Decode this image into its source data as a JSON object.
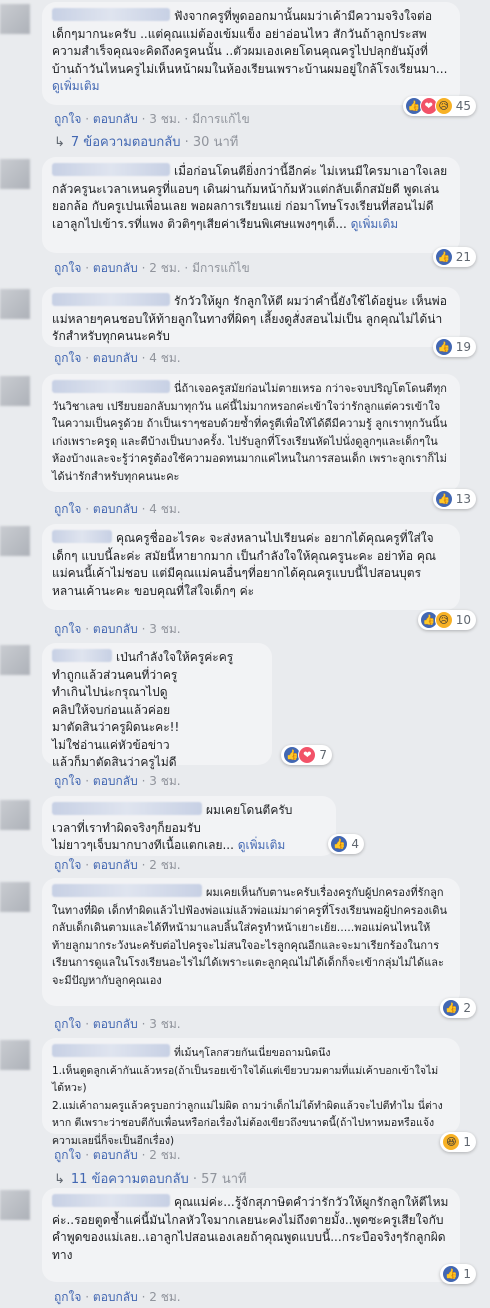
{
  "actions": {
    "like": "ถูกใจ",
    "reply": "ตอบกลับ",
    "dot": "·",
    "edited": "มีการแก้ไข",
    "see_more": "ดูเพิ่มเติม"
  },
  "comments": [
    {
      "text": "ฟังจากครูที่พูดออกมานั้นผมว่าเค้ามีความจริงใจต่อเด็กๆมากนะครับ ..แต่คุณแม่ต้องเข้มแข็ง อย่าอ่อนไหว สักวันถ้าลูกประสพความสำเร็จคุณจะคิดถึงครูคนนั้น ..ตัวผมเองเคยโดนคุณครูไปปลุกยันมุ้งที่บ้านถ้าวันไหนครูไม่เห็นหน้าผมในห้องเรียนเพราะบ้านผมอยู่ใกล้โรงเรียนมา...",
      "see_more": true,
      "time": "3 ชม.",
      "edited": true,
      "reactions": {
        "icons": [
          "like",
          "love",
          "sad"
        ],
        "count": "45"
      }
    },
    {
      "text": "เมื่อก่อนโดนตียิ่งกว่านี้อีกค่ะ ไม่เหนมีใครมาเอาใจเลย กลัวครูนะเวลาเหนครูที่แอบๆ เดินผ่านก้มหน้าก้มหัวแต่กลับเด็กสมัยดี พูดเล่นยอกล้อ กับครูเปนเพื่อนเลย พอผลการเรียนแย่ ก่อมาโทษโรงเรียนที่สอนไม่ดีเอาลูกไปเข้าร.รที่แพง ติวติๆๆเสียค่าเรียนพิเศษแพงๆๆเต็...",
      "see_more": true,
      "time": "2 ชม.",
      "edited": true,
      "reactions": {
        "icons": [
          "like"
        ],
        "count": "21"
      }
    },
    {
      "text": "รักวัวให้ผูก รักลูกให้ตี ผมว่าคำนี้ยังใช้ได้อยู่นะ เห็นพ่อแม่หลายๆคนชอบให้ท้ายลูกในทางที่ผิดๆ เลี้ยงดูสั่งสอนไม่เป็น ลูกคุณไม่ได้น่ารักสำหรับทุกคนนะครับ",
      "see_more": false,
      "time": "4 ชม.",
      "edited": false,
      "reactions": {
        "icons": [
          "like"
        ],
        "count": "19"
      }
    },
    {
      "text": "นี่ถ้าเจอครูสมัยก่อนไม่ตายเหรอ กว่าจะจบปริญโตโดนตีทุกวันวิชาเลข เปรียบยอกลับมาทุกวัน แค่นี้ไม่มากหรอกค่ะเข้าใจว่ารักลูกแต่ควรเข้าใจในความเป็นครูด้วย ถ้าเป็นเราๆชอบด้วยซ้ำที่ครูตีเพื่อให้ได้ดีมีความรู้ ลูกเราทุกวันนิ้นเก่งเพราะครูดุ และตีบ้างเป็นบางครั้ง. ไปรับลูกที่โรงเรียนหัดไปนั่งดูลูกๆและเด็กๆในห้องบ้างและจะรู้ว่าครูต้องใช้ความอดทนมากแค่ไหนในการสอนเด็ก เพราะลูกเราก็ไม่ได้น่ารักสำหรับทุกคนนะคะ",
      "see_more": false,
      "time": "4 ชม.",
      "edited": false,
      "reactions": {
        "icons": [
          "like"
        ],
        "count": "13"
      }
    },
    {
      "text": "คุณครูชื่ออะไรคะ จะส่งหลานไปเรียนค่ะ อยากได้คุณครูที่ใส่ใจเด็กๆ แบบนี้ละค่ะ สมัยนี้หายากมาก เป็นกำลังใจให้คุณครูนะคะ อย่าท้อ คุณแม่คนนี้เค้าไม่ชอบ แต่มีคุณแม่คนอื่นๆที่อยากได้คุณครูแบบนี้ไปสอนบุตรหลานเค้านะคะ ขอบคุณที่ใส่ใจเด็กๆ ค่ะ",
      "see_more": false,
      "time": "3 ชม.",
      "edited": false,
      "reactions": {
        "icons": [
          "like",
          "sad"
        ],
        "count": "10"
      }
    },
    {
      "text": "เป่นกำลังใจให้ครูค่ะครู\nทำถูกแล้วส่วนคนที่ว่าครู\nทำเกินไปน่ะกรุณาไปดู\nคลิปให้จบก่อนแล้วค่อย\nมาตัดสินว่าครูผิดนะคะ!!\nไม่ใช่อ่านแค่หัวข้อข่าว\nแล้วก็มาตัดสินว่าครูไม่ดี",
      "see_more": false,
      "time": "3 ชม.",
      "edited": false,
      "reactions": {
        "icons": [
          "like",
          "love"
        ],
        "count": "7"
      }
    },
    {
      "text": "ผมเคยโดนตีครับ\nเวลาที่เราทำผิดจริงๆก็ยอมรับ\nไม่ยาวๆเจ็บมากบางทีเนื้อแตกเลย...",
      "see_more": true,
      "time": "2 ชม.",
      "edited": false,
      "reactions": {
        "icons": [
          "like"
        ],
        "count": "4"
      }
    },
    {
      "text": "ผมเคยเห็นกับตานะครับเรื่องครูกับผู้ปกครองที่รักลูกในทางที่ผิด เด็กทำผิดแล้วไปฟ้องพ่อแม่แล้วพ่อแม่มาด่าครูที่โรงเรียนพอผู้ปกครองเดินกลับเด็กเดินตามและได้ทีหน้ามาแลบลิ้นใส่ครูทำหน้าเยาะเย้ย.....พอแม่คนไหนให้ท้ายลูกมากระวังนะครับต่อไปครูจะไม่สนใจอะไรลูกคุณอีกและจะมาเรียกร้องในการเรียนการดูแลในโรงเรียนอะไรไม่ได้เพราะแตะลูกคุณไม่ได้เด็กก็จะเข้ากลุ่มไม่ได้และจะมีปัญหากับลูกคุณเอง",
      "see_more": false,
      "time": "3 ชม.",
      "edited": false,
      "reactions": {
        "icons": [
          "like"
        ],
        "count": "2"
      }
    },
    {
      "text": "ที่เม้นๆโลกสวยกันเนี่ยขอถามนิดนึง\n1.เห็นตูดลูกเค้ากันแล้วหรอ(ถ้าเป็นรอยเข้าใจได้แต่เขียวบวมตามที่แม่เค้าบอกเข้าใจไม่ได้หวะ)\n2.แม่เค้าถามครูแล้วครูบอกว่าลูกแม่ไม่ผิด ถามว่าเด็กไม่ได้ทำผิดแล้วจะไปตีทำไม นี่ต่างหาก ตีเพราะว่าชอบตีกับเพื่อนหรือก่อเรื่องไม่ต้องเขียวถึงขนาดนี้(ถ้าไปหาหมอหรือแจ้งความเลยนี่ก็จะเป็นอีกเรื่อง)",
      "see_more": false,
      "time": "2 ชม.",
      "edited": false,
      "reactions": {
        "icons": [
          "haha"
        ],
        "count": "1"
      }
    },
    {
      "text": "คุณแม่ค่ะ...รู้จักสุภาษิตคำว่ารักวัวให้ผูกรักลูกให้ตีไหมค่ะ..รอยตูดช้ำแค่นี้มันไกลหัวใจมากเลยนะคงไม่ถึงตายมั้ง..พูดซะครูเสียใจกับคำพูดของแม่เลย..เอาลูกไปสอนเองเลยถ้าคุณพูดแบบนี้...กระบือจริงๆรักลูกผิดทาง",
      "see_more": false,
      "time": "2 ชม.",
      "edited": false,
      "reactions": {
        "icons": [
          "like"
        ],
        "count": "1"
      }
    }
  ],
  "reply_links": [
    {
      "label": "7 ข้อความตอบกลับ",
      "time": "30 นาที"
    },
    {
      "label": "11 ข้อความตอบกลับ",
      "time": "57 นาที"
    }
  ],
  "icons": {
    "like": "👍",
    "love": "❤",
    "sad": "😥",
    "haha": "😆"
  },
  "colors": {
    "link": "#4267b2",
    "meta": "#90949c",
    "bubble": "#f2f3f5",
    "background": "#e9ebee"
  }
}
